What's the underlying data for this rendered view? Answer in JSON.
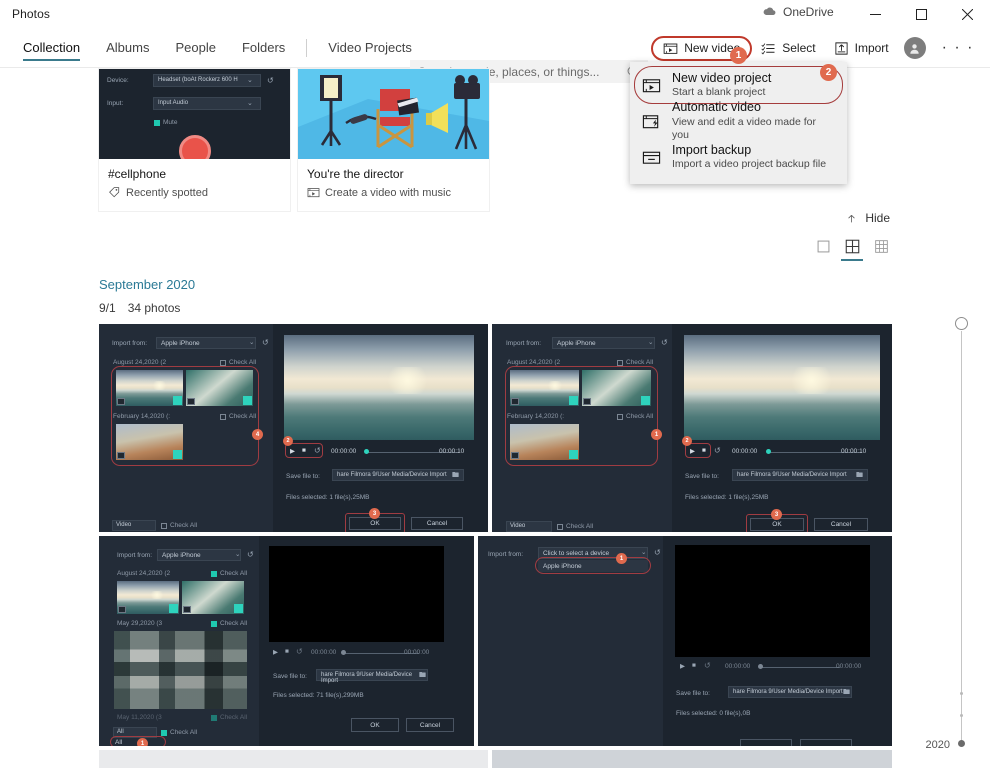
{
  "window": {
    "app_title": "Photos",
    "onedrive_label": "OneDrive",
    "minimize": "minimize-icon",
    "maximize": "maximize-icon",
    "close": "close-icon"
  },
  "nav": {
    "tabs": [
      {
        "label": "Collection",
        "active": true
      },
      {
        "label": "Albums",
        "active": false
      },
      {
        "label": "People",
        "active": false
      },
      {
        "label": "Folders",
        "active": false
      },
      {
        "label": "Video Projects",
        "active": false
      }
    ]
  },
  "search": {
    "placeholder": "Search people, places, or things...",
    "value": "",
    "icon": "search-icon"
  },
  "commands": {
    "new_video": {
      "label": "New video",
      "icon": "video-project-icon",
      "badge": "1",
      "highlighted": true
    },
    "select": {
      "label": "Select",
      "icon": "select-icon"
    },
    "import": {
      "label": "Import",
      "icon": "import-icon"
    },
    "account": {
      "icon": "account-avatar-icon"
    },
    "more": {
      "label": "· · ·",
      "icon": "more-options-icon"
    }
  },
  "menu": {
    "badge": "2",
    "items": [
      {
        "title": "New video project",
        "subtitle": "Start a blank project",
        "icon": "video-project-icon",
        "highlighted": true
      },
      {
        "title": "Automatic video",
        "subtitle": "View and edit a video made for you",
        "icon": "auto-video-icon",
        "highlighted": false
      },
      {
        "title": "Import backup",
        "subtitle": "Import a video project backup file",
        "icon": "import-backup-icon",
        "highlighted": false
      }
    ]
  },
  "creations": {
    "cards": [
      {
        "title": "#cellphone",
        "subtitle": "Recently spotted",
        "icon": "tag-icon"
      },
      {
        "title": "You're the director",
        "subtitle": "Create a video with music",
        "icon": "video-project-icon"
      }
    ]
  },
  "hide_button": {
    "label": "Hide",
    "icon": "chevron-up-icon"
  },
  "view_modes": [
    {
      "name": "view-single",
      "icon": "single-square-icon",
      "selected": false
    },
    {
      "name": "view-medium-grid",
      "icon": "grid-4-icon",
      "selected": true
    },
    {
      "name": "view-small-grid",
      "icon": "grid-9-icon",
      "selected": false
    }
  ],
  "group": {
    "month": "September 2020",
    "date": "9/1",
    "count": "34 photos"
  },
  "scrubber": {
    "year": "2020"
  },
  "photos": [
    {
      "name": "photo-filmora-import-1",
      "import_from_label": "Import from:",
      "device": "Apple iPhone",
      "groups": [
        {
          "title": "August 24,2020 (2",
          "check_all": "Check All",
          "checked": false
        },
        {
          "title": "February 14,2020 (:",
          "check_all": "Check All",
          "checked": false
        }
      ],
      "time_current": "00:00:00",
      "time_total": "00:00:10",
      "save_label": "Save file to:",
      "save_path": "hare Filmora 9/User Media/Device Import",
      "files_selected": "Files selected:  1 file(s),25MB",
      "ok": "OK",
      "cancel": "Cancel",
      "bottom_filter": "Video",
      "bottom_check_all": "Check All",
      "badges": [
        "4",
        "2",
        "3"
      ],
      "preview": "sea-sunset"
    },
    {
      "name": "photo-filmora-import-2",
      "import_from_label": "Import from:",
      "device": "Apple iPhone",
      "groups": [
        {
          "title": "August 24,2020 (2",
          "check_all": "Check All",
          "checked": false
        },
        {
          "title": "February 14,2020 (:",
          "check_all": "Check All",
          "checked": false
        }
      ],
      "time_current": "00:00:00",
      "time_total": "00:00:10",
      "save_label": "Save file to:",
      "save_path": "hare Filmora 9/User Media/Device Import",
      "files_selected": "Files selected:  1 file(s),25MB",
      "ok": "OK",
      "cancel": "Cancel",
      "bottom_filter": "Video",
      "bottom_check_all": "Check All",
      "badges": [
        "1",
        "2",
        "3"
      ],
      "preview": "sea-sunset"
    },
    {
      "name": "photo-filmora-import-3",
      "import_from_label": "Import from:",
      "device": "Apple iPhone",
      "groups": [
        {
          "title": "August 24,2020 (2",
          "check_all": "Check All",
          "checked": true
        },
        {
          "title": "May 29,2020 (3",
          "check_all": "Check All",
          "checked": true
        }
      ],
      "time_current": "00:00:00",
      "time_total": "00:00:00",
      "save_label": "Save file to:",
      "save_path": "hare Filmora 9/User Media/Device Import",
      "files_selected": "Files selected:  71 file(s),299MB",
      "ok": "OK",
      "cancel": "Cancel",
      "bottom_filter": "All",
      "bottom_check_all": "Check All",
      "bottom_option": "All",
      "badges": [
        "1"
      ],
      "preview": "black"
    },
    {
      "name": "photo-filmora-import-4",
      "import_from_label": "Import from:",
      "device": "Click to select a device",
      "device_option": "Apple iPhone",
      "groups": [],
      "time_current": "00:00:00",
      "time_total": "00:00:00",
      "save_label": "Save file to:",
      "save_path": "hare Filmora 9/User Media/Device Import",
      "files_selected": "Files selected:  0 file(s),0B",
      "ok": "",
      "cancel": "",
      "badges": [
        "1"
      ],
      "preview": "black"
    }
  ],
  "colors": {
    "accent": "#3a7a8c",
    "badge": "#e06a4e",
    "highlight_ring": "#c0392b",
    "month_link": "#2b7a96"
  }
}
